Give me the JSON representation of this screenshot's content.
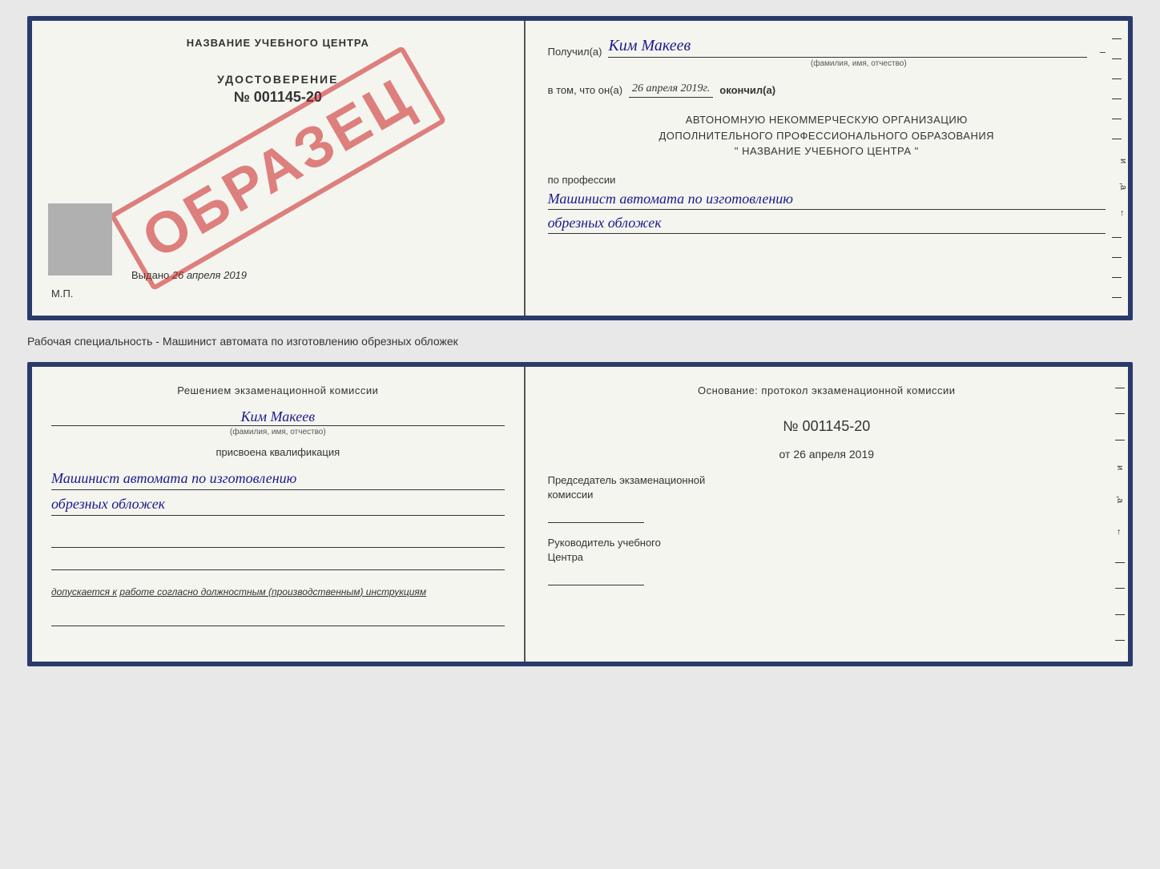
{
  "topCert": {
    "left": {
      "schoolName": "НАЗВАНИЕ УЧЕБНОГО ЦЕНТРА",
      "udostoverenie": "УДОСТОВЕРЕНИЕ",
      "number": "№ 001145-20",
      "vydano": "Выдано",
      "vydanoDate": "26 апреля 2019",
      "mp": "М.П.",
      "obrazec": "ОБРАЗЕЦ"
    },
    "right": {
      "recipientLabel": "Получил(а)",
      "recipientName": "Ким Макеев",
      "recipientSubtitle": "(фамилия, имя, отчество)",
      "dateLabel": "в том, что он(а)",
      "dateValue": "26 апреля 2019г.",
      "dateEnd": "окончил(а)",
      "orgLine1": "АВТОНОМНУЮ НЕКОММЕРЧЕСКУЮ ОРГАНИЗАЦИЮ",
      "orgLine2": "ДОПОЛНИТЕЛЬНОГО ПРОФЕССИОНАЛЬНОГО ОБРАЗОВАНИЯ",
      "orgLine3": "\" НАЗВАНИЕ УЧЕБНОГО ЦЕНТРА \"",
      "professionLabel": "по профессии",
      "professionLine1": "Машинист автомата по изготовлению",
      "professionLine2": "обрезных обложек"
    }
  },
  "middleText": "Рабочая специальность - Машинист автомата по изготовлению обрезных обложек",
  "bottomCert": {
    "left": {
      "headerLine1": "Решением экзаменационной комиссии",
      "name": "Ким Макеев",
      "nameSubtitle": "(фамилия, имя, отчество)",
      "qualifLabel": "присвоена квалификация",
      "qualifLine1": "Машинист автомата по изготовлению",
      "qualifLine2": "обрезных обложек",
      "dopuskaetsyaLabel": "допускается к",
      "dopuskaetsyaText": "работе согласно должностным (производственным) инструкциям"
    },
    "right": {
      "osnovanieLabel": "Основание: протокол экзаменационной комиссии",
      "protocolNumber": "№ 001145-20",
      "protocolDatePrefix": "от",
      "protocolDate": "26 апреля 2019",
      "chairmanLabel": "Председатель экзаменационной",
      "chairmanLabel2": "комиссии",
      "rukovodLabel": "Руководитель учебного",
      "rukovodLabel2": "Центра"
    }
  }
}
